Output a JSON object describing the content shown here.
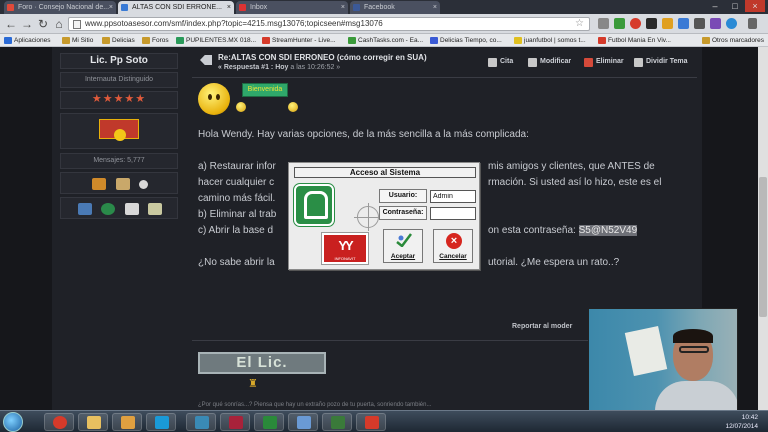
{
  "browser": {
    "tabs": [
      {
        "label": "Foro · Consejo Nacional de..."
      },
      {
        "label": "ALTAS CON SDI ERRONE..."
      },
      {
        "label": "Inbox"
      },
      {
        "label": "Facebook"
      }
    ],
    "url": "www.ppsotoasesor.com/smf/index.php?topic=4215.msg13076;topicseen#msg13076",
    "bookmarks": [
      "Aplicaciones",
      "Mi Sitio",
      "Delicias",
      "Foros",
      "PUPILENTES.MX 018...",
      "StreamHunter - Live...",
      "CashTasks.com - Ea...",
      "Delicias Tiempo, co...",
      "juanfutbol | somos t...",
      "Futbol Mania En Viv...",
      "Otros marcadores"
    ]
  },
  "profile": {
    "username": "Lic. Pp Soto",
    "rank": "Internauta Distinguido",
    "stars": "★★★★★",
    "messages": "Mensajes: 5,777"
  },
  "post": {
    "title": "Re:ALTAS CON SDI ERRONEO (cómo corregir en SUA)",
    "reply_label": "« Respuesta #1 : Hoy",
    "reply_time": "a las 10:26:52 »",
    "actions": {
      "quote": "Cita",
      "modify": "Modificar",
      "delete": "Eliminar",
      "split": "Dividir Tema"
    },
    "sign_text": "Bienvenida",
    "greeting": "Hola Wendy.  Hay varias opciones, de la más sencilla a la más complicada:",
    "line_a1": "a) Restaurar infor",
    "line_a1_end": "mis amigos y clientes, que ANTES de",
    "line_a2": "hacer cualquier c",
    "line_a2_end": "rmación.  Si usted así lo hizo, este es el",
    "line_a3": "camino más fácil.",
    "line_b": "b) Eliminar al trab",
    "line_c": "c) Abrir la base d",
    "line_c_end": "on esta contraseña:",
    "password": "S5@N52V49",
    "line_d": "¿No sabe abrir la",
    "line_d_end": "utorial.  ¿Me espera un rato..?",
    "report": "Reportar al moder",
    "signature_logo": "El Lic.",
    "quote_line": "¿Por qué sonrías...? Piensa que hay un extraño pozo de tu puerta, sonriendo también..."
  },
  "dialog": {
    "title": "Acceso al Sistema",
    "user_label": "Usuario:",
    "user_value": "Admin",
    "password_label": "Contraseña:",
    "password_value": "",
    "accept": "Aceptar",
    "cancel": "Cancelar",
    "infonavit": "INFONAVIT"
  },
  "taskbar": {
    "time": "10:42",
    "date": "12/07/2014"
  }
}
